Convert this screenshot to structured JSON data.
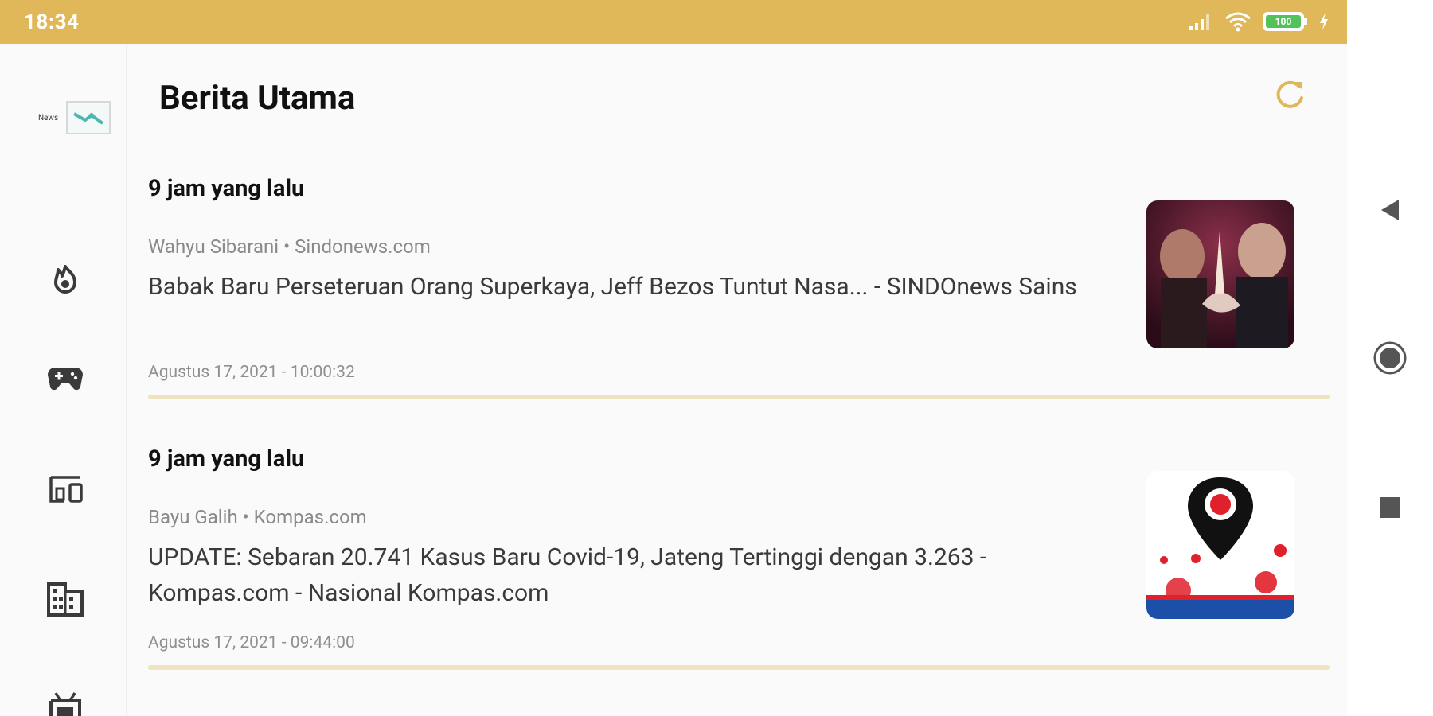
{
  "status_bar": {
    "time": "18:34",
    "battery": "100"
  },
  "sidebar": {
    "logo_text": "News",
    "items": [
      {
        "name": "trending"
      },
      {
        "name": "games"
      },
      {
        "name": "technology"
      },
      {
        "name": "business"
      },
      {
        "name": "entertainment"
      }
    ]
  },
  "header": {
    "title": "Berita Utama"
  },
  "articles": [
    {
      "time_ago": "9 jam yang lalu",
      "source": "Wahyu Sibarani • Sindonews.com",
      "headline": "Babak Baru Perseteruan Orang Superkaya, Jeff Bezos Tuntut Nasa... - SINDOnews Sains",
      "date": "Agustus 17, 2021 - 10:00:32"
    },
    {
      "time_ago": "9 jam yang lalu",
      "source": "Bayu Galih • Kompas.com",
      "headline": "UPDATE: Sebaran 20.741 Kasus Baru Covid-19, Jateng Tertinggi dengan 3.263 - Kompas.com - Nasional Kompas.com",
      "date": "Agustus 17, 2021 - 09:44:00"
    }
  ],
  "colors": {
    "accent": "#e0b85a",
    "divider": "#f0e3bf"
  }
}
